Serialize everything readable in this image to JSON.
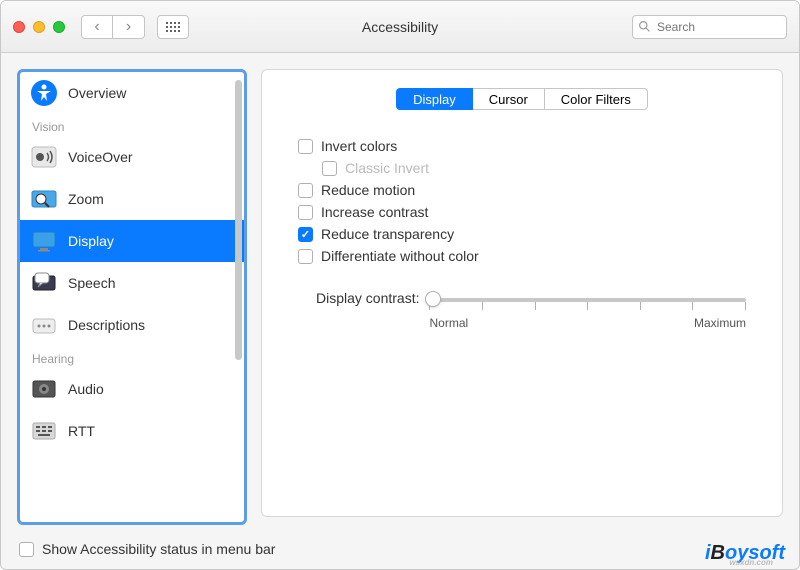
{
  "window": {
    "title": "Accessibility"
  },
  "search": {
    "placeholder": "Search"
  },
  "sidebar": {
    "items": [
      {
        "label": "Overview",
        "icon": "overview"
      },
      {
        "section": "Vision"
      },
      {
        "label": "VoiceOver",
        "icon": "voiceover"
      },
      {
        "label": "Zoom",
        "icon": "zoom"
      },
      {
        "label": "Display",
        "icon": "display",
        "selected": true
      },
      {
        "label": "Speech",
        "icon": "speech"
      },
      {
        "label": "Descriptions",
        "icon": "descriptions"
      },
      {
        "section": "Hearing"
      },
      {
        "label": "Audio",
        "icon": "audio"
      },
      {
        "label": "RTT",
        "icon": "rtt"
      }
    ]
  },
  "tabs": [
    {
      "label": "Display",
      "active": true
    },
    {
      "label": "Cursor",
      "active": false
    },
    {
      "label": "Color Filters",
      "active": false
    }
  ],
  "options": {
    "invert_colors": {
      "label": "Invert colors",
      "checked": false
    },
    "classic_invert": {
      "label": "Classic Invert",
      "checked": false,
      "disabled": true
    },
    "reduce_motion": {
      "label": "Reduce motion",
      "checked": false
    },
    "increase_contrast": {
      "label": "Increase contrast",
      "checked": false
    },
    "reduce_transparency": {
      "label": "Reduce transparency",
      "checked": true
    },
    "differentiate": {
      "label": "Differentiate without color",
      "checked": false
    }
  },
  "slider": {
    "label": "Display contrast:",
    "min_label": "Normal",
    "max_label": "Maximum",
    "value": 0
  },
  "footer": {
    "label": "Show Accessibility status in menu bar",
    "checked": false
  },
  "watermark": {
    "brand_i": "i",
    "brand_b": "B",
    "brand_rest": "oysoft",
    "url": "wsxdn.com"
  }
}
